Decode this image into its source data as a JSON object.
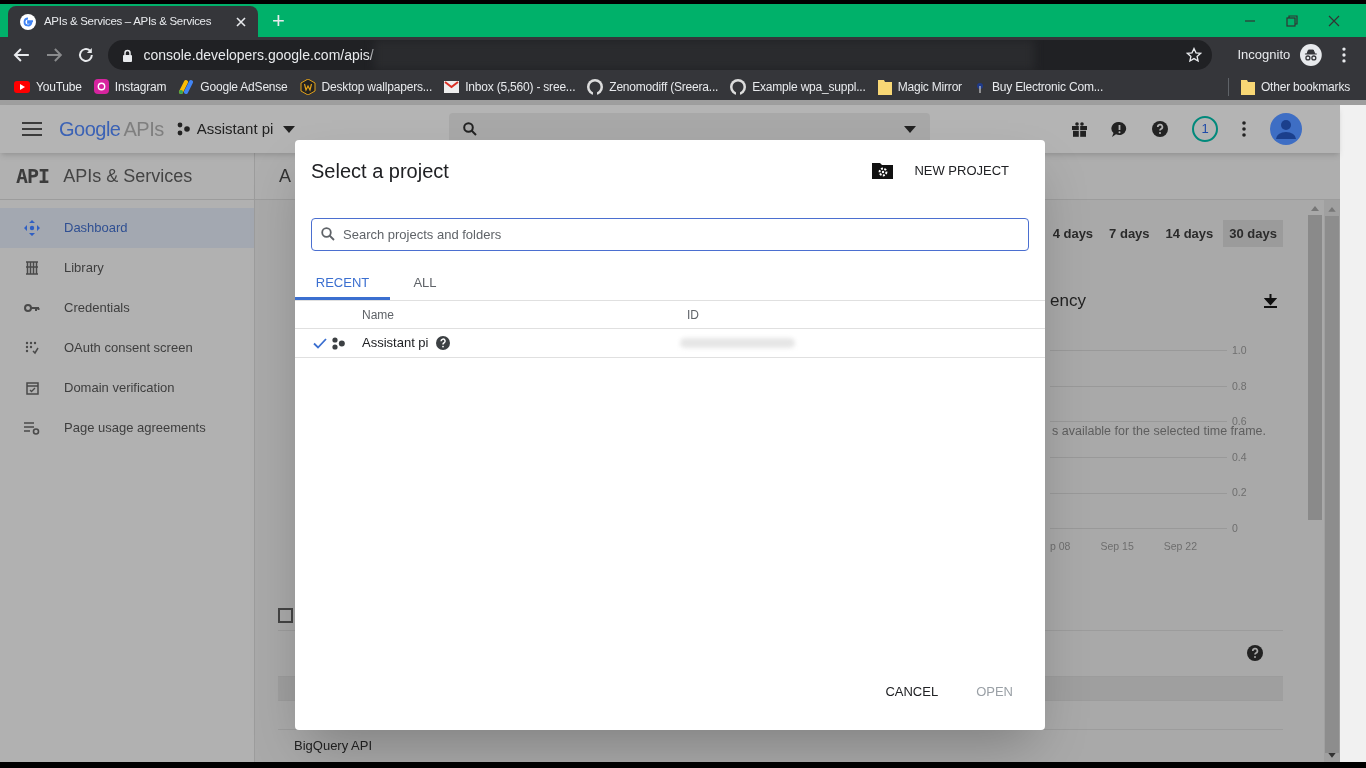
{
  "browser": {
    "tab_title": "APIs & Services – APIs & Services",
    "new_tab": "+",
    "url": "console.developers.google.com/apis/",
    "profile": "Incognito",
    "bookmarks": [
      {
        "label": "YouTube",
        "kind": "youtube"
      },
      {
        "label": "Instagram",
        "kind": "instagram"
      },
      {
        "label": "Google AdSense",
        "kind": "adsense"
      },
      {
        "label": "Desktop wallpapers...",
        "kind": "wallpaper"
      },
      {
        "label": "Inbox (5,560) - sree...",
        "kind": "mail"
      },
      {
        "label": "Zenomodiff (Sreera...",
        "kind": "github"
      },
      {
        "label": "Example wpa_suppl...",
        "kind": "github"
      },
      {
        "label": "Magic Mirror",
        "kind": "folder"
      },
      {
        "label": "Buy Electronic Com...",
        "kind": "site"
      }
    ],
    "other_bookmarks": "Other bookmarks"
  },
  "header": {
    "brand_google": "Google",
    "brand_apis": "APIs",
    "project": "Assistant pi",
    "notification_count": "1"
  },
  "sidebar": {
    "badge": "API",
    "title": "APIs & Services",
    "items": [
      {
        "label": "Dashboard",
        "kind": "dashboard",
        "selected": true
      },
      {
        "label": "Library",
        "kind": "library",
        "selected": false
      },
      {
        "label": "Credentials",
        "kind": "credentials",
        "selected": false
      },
      {
        "label": "OAuth consent screen",
        "kind": "oauth",
        "selected": false
      },
      {
        "label": "Domain verification",
        "kind": "domain",
        "selected": false
      },
      {
        "label": "Page usage agreements",
        "kind": "agreements",
        "selected": false
      }
    ]
  },
  "main": {
    "heading": "A",
    "checkbox_checked": false,
    "time_ranges": [
      {
        "label": "4 days",
        "selected": false
      },
      {
        "label": "7 days",
        "selected": false
      },
      {
        "label": "14 days",
        "selected": false
      },
      {
        "label": "30 days",
        "selected": true
      }
    ],
    "chart_title": "ency",
    "y_labels": [
      "1.0",
      "0.8",
      "0.6",
      "0.4",
      "0.2",
      "0"
    ],
    "message": "s available for the selected time frame.",
    "x_labels": [
      "p 08",
      "Sep 15",
      "Sep 22"
    ],
    "table_row": "BigQuery API"
  },
  "dialog": {
    "title": "Select a project",
    "new_project": "NEW PROJECT",
    "search_placeholder": "Search projects and folders",
    "tabs": [
      {
        "label": "RECENT",
        "selected": true
      },
      {
        "label": "ALL",
        "selected": false
      }
    ],
    "columns": [
      "Name",
      "ID"
    ],
    "rows": [
      {
        "name": "Assistant pi",
        "checked": true
      }
    ],
    "buttons": [
      {
        "label": "CANCEL",
        "disabled": false
      },
      {
        "label": "OPEN",
        "disabled": true
      }
    ]
  }
}
